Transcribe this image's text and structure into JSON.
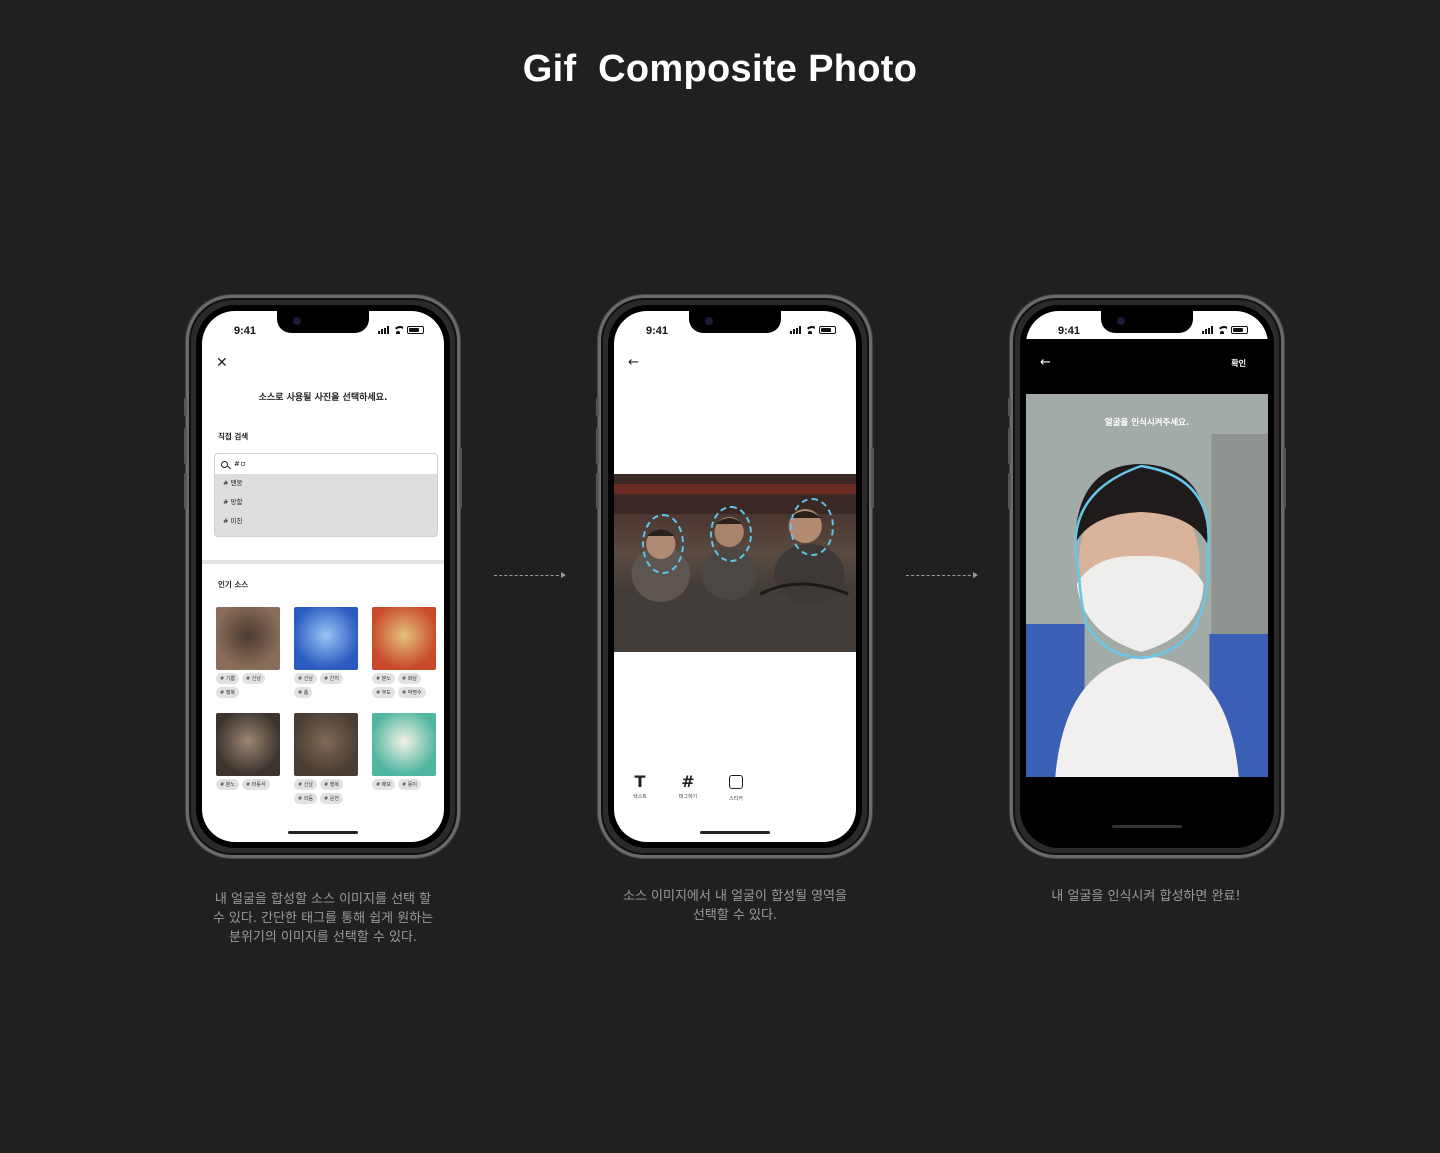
{
  "page": {
    "title": "Gif  Composite Photo"
  },
  "status_time": "9:41",
  "screen1": {
    "heading": "소스로 사용될 사진을 선택하세요.",
    "search_section_label": "직접 검색",
    "search_value": "#ㅁ",
    "suggestions": [
      "# 맨붕",
      "# 망함",
      "# 미친"
    ],
    "popular_label": "인기 소스",
    "sources": [
      {
        "tags": [
          "# 기쁨",
          "# 신남",
          "# 행복"
        ],
        "palette": [
          "#8a6d5a",
          "#4a3a33"
        ]
      },
      {
        "tags": [
          "# 신남",
          "# 간지",
          "# 춤"
        ],
        "palette": [
          "#2b5bbf",
          "#9bc4f5"
        ]
      },
      {
        "tags": [
          "# 분노",
          "# 화남",
          "# 무도",
          "# 박명수"
        ],
        "palette": [
          "#c94b2b",
          "#e3c27c"
        ]
      },
      {
        "tags": [
          "# 분노",
          "# 마동석"
        ],
        "palette": [
          "#3b342e",
          "#9b8672"
        ]
      },
      {
        "tags": [
          "# 신남",
          "# 행복",
          "# 리듬",
          "# 운전"
        ],
        "palette": [
          "#4a3d33",
          "#7e6a58"
        ]
      },
      {
        "tags": [
          "# 메모",
          "# 몽이"
        ],
        "palette": [
          "#4fb6a0",
          "#f4f1e6"
        ]
      }
    ]
  },
  "screen2": {
    "tools": [
      {
        "glyph": "T",
        "label": "텍스트",
        "icon": "text-icon"
      },
      {
        "glyph": "#",
        "label": "태그하기",
        "icon": "hashtag-icon"
      },
      {
        "glyph": "",
        "label": "스티커",
        "icon": "sticker-icon"
      }
    ]
  },
  "screen3": {
    "confirm_label": "확인",
    "instruction": "얼굴을 인식시켜주세요."
  },
  "captions": [
    "내 얼굴을 합성할 소스 이미지를 선택 할\n수 있다. 간단한 태그를 통해 쉽게 원하는\n분위기의 이미지를 선택할 수 있다.",
    "소스 이미지에서 내 얼굴이 합성될 영역을\n선택할 수 있다.",
    "내 얼굴을 인식시켜 합성하면 완료!"
  ]
}
